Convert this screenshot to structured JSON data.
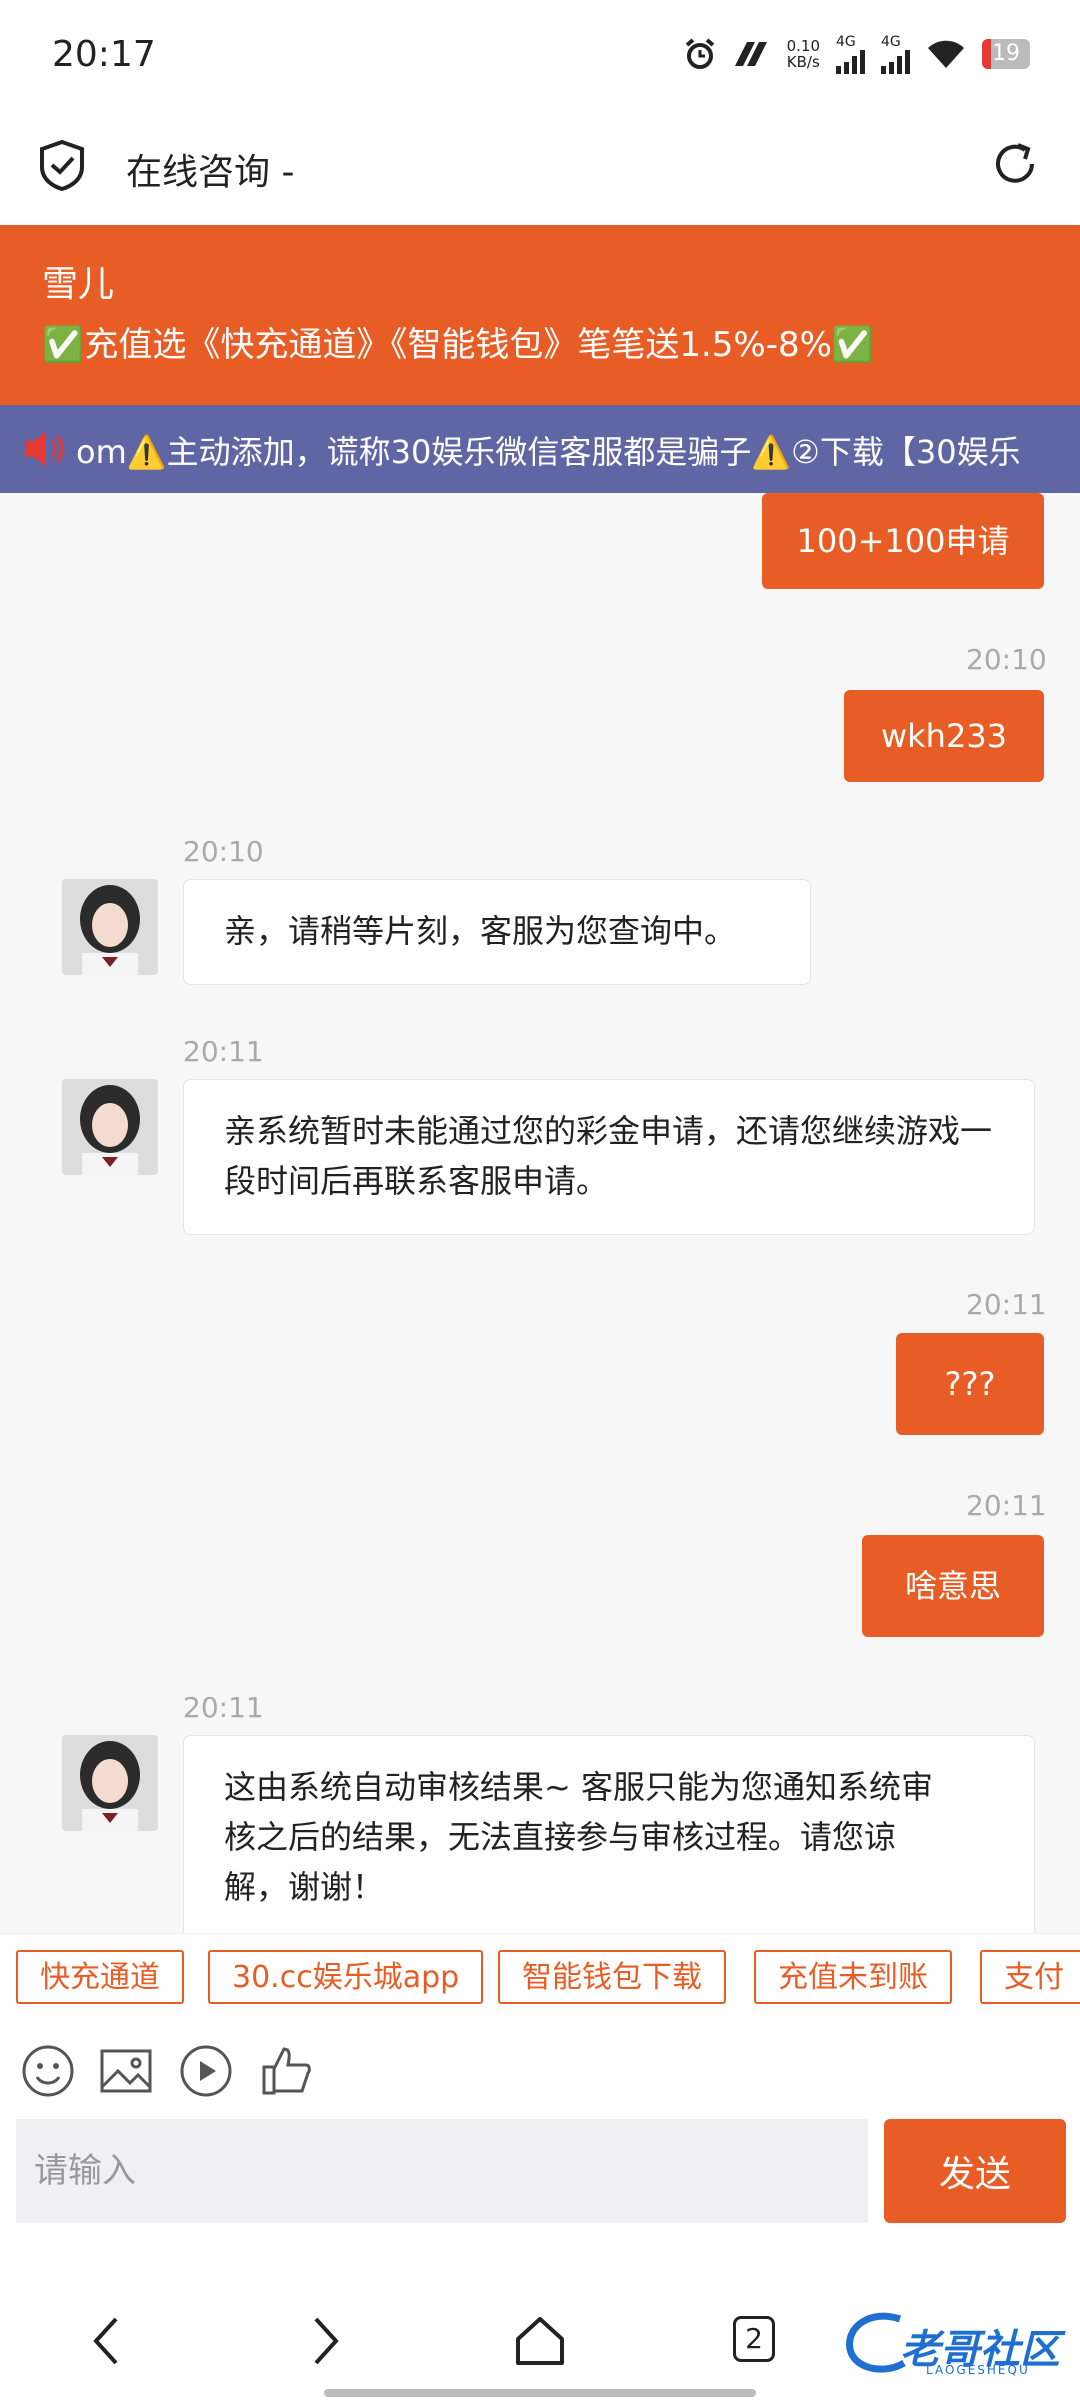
{
  "status_bar": {
    "time": "20:17",
    "net_speed": "0.10",
    "net_unit": "KB/s",
    "sim1": "4G",
    "sim2": "4G",
    "battery": "19",
    "battery_fraction": 0.19
  },
  "header": {
    "title": "在线咨询 -"
  },
  "announcement": {
    "name": "雪儿",
    "promo": "✅充值选《快充通道》《智能钱包》笔笔送1.5%-8%✅"
  },
  "marquee": {
    "text": "om⚠️主动添加，谎称30娱乐微信客服都是骗子⚠️②下载【30娱乐"
  },
  "messages": [
    {
      "dir": "out",
      "time": "",
      "text": "100+100申请"
    },
    {
      "dir": "out",
      "time": "20:10",
      "text": "wkh233"
    },
    {
      "dir": "in",
      "time": "20:10",
      "text": "亲，请稍等片刻，客服为您查询中。"
    },
    {
      "dir": "in",
      "time": "20:11",
      "text": "亲系统暂时未能通过您的彩金申请，还请您继续游戏一段时间后再联系客服申请。"
    },
    {
      "dir": "out",
      "time": "20:11",
      "text": "???"
    },
    {
      "dir": "out",
      "time": "20:11",
      "text": "啥意思"
    },
    {
      "dir": "in",
      "time": "20:11",
      "text": "这由系统自动审核结果~ 客服只能为您通知系统审核之后的结果，无法直接参与审核过程。请您谅解，谢谢！"
    }
  ],
  "quick_replies": [
    "快充通道",
    "30.cc娱乐城app",
    "智能钱包下载",
    "充值未到账",
    "支付"
  ],
  "toolbar": {
    "icons": [
      "emoji-icon",
      "image-icon",
      "video-icon",
      "thumbs-up-icon"
    ]
  },
  "composer": {
    "placeholder": "请输入",
    "send_label": "发送"
  },
  "navbar": {
    "tab_count": "2",
    "watermark": "老哥社区",
    "watermark_sub": "LAOGESHEQU"
  },
  "colors": {
    "accent": "#e85d26",
    "marquee_bg": "#5f66a3",
    "watermark": "#1e6fd0"
  }
}
